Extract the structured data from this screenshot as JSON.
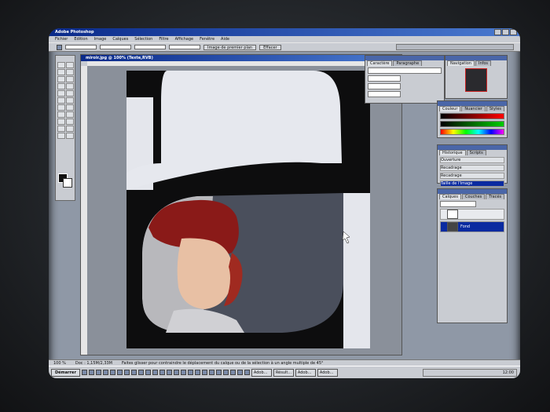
{
  "app": {
    "title": "Adobe Photoshop",
    "menus": [
      "Fichier",
      "Edition",
      "Image",
      "Calques",
      "Sélection",
      "Filtre",
      "Affichage",
      "Fenêtre",
      "Aide"
    ]
  },
  "options_bar": {
    "button_1": "Image de premier plan",
    "button_2": "Effacer"
  },
  "document": {
    "title": "miroir.jpg @ 100% (Texte,RVB)"
  },
  "panels": {
    "character": {
      "tabs": [
        "Caractère",
        "Paragraphe"
      ]
    },
    "navigator": {
      "tabs": [
        "Navigation",
        "Infos"
      ]
    },
    "color": {
      "tabs": [
        "Couleur",
        "Nuancier",
        "Styles"
      ]
    },
    "history": {
      "tabs": [
        "Historique",
        "Scripts"
      ],
      "items": [
        "Ouverture",
        "Recadrage",
        "Recadrage",
        "Taille de l'image"
      ]
    },
    "layers": {
      "tabs": [
        "Calques",
        "Couches",
        "Tracés"
      ],
      "layer_name": "Fond"
    }
  },
  "status": {
    "zoom": "100 %",
    "doc": "Doc : 1,15M/2,33M",
    "hint": "Faites glisser pour contraindre le déplacement du calque ou de la sélection à un angle multiple de 45°"
  },
  "taskbar": {
    "start": "Démarrer",
    "buttons": [
      "Adob...",
      "Résult...",
      "Adob...",
      "Adob..."
    ],
    "clock": "12:00"
  },
  "colors": {
    "title_blue": "#0a2a8a",
    "chrome_gray": "#c9ccd2",
    "selection_blue": "#0a2aa0"
  }
}
